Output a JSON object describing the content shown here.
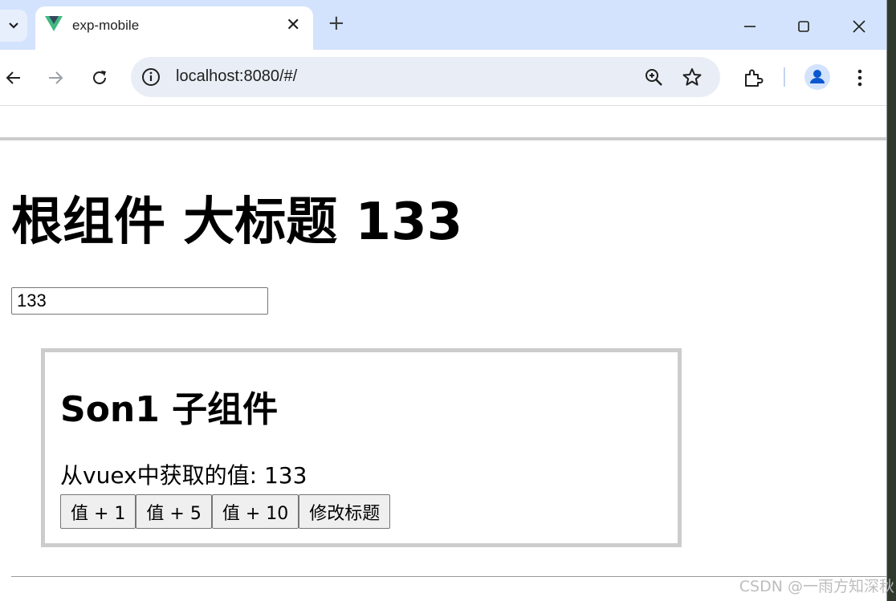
{
  "browser": {
    "tab": {
      "title": "exp-mobile",
      "close_glyph": "✕"
    },
    "new_tab_glyph": "+",
    "address": {
      "url": "localhost:8080/#/"
    },
    "colors": {
      "tabstrip": "#d3e3fd",
      "omnibox": "#e9eef6",
      "accent": "#0b57d0",
      "vue_green": "#42b883",
      "vue_dark": "#35495e"
    },
    "icons": [
      "tab-search-icon",
      "vue-logo-icon",
      "close-icon",
      "plus-icon",
      "minimize-icon",
      "maximize-icon",
      "window-close-icon",
      "back-icon",
      "forward-icon",
      "reload-icon",
      "site-info-icon",
      "zoom-icon",
      "star-icon",
      "extensions-icon",
      "profile-icon",
      "menu-icon"
    ]
  },
  "page": {
    "heading": "根组件 大标题 133",
    "input_value": "133",
    "son1": {
      "title": "Son1 子组件",
      "value_text": "从vuex中获取的值: 133",
      "buttons": [
        "值 + 1",
        "值 + 5",
        "值 + 10",
        "修改标题"
      ]
    }
  },
  "watermark": "CSDN @一雨方知深秋"
}
